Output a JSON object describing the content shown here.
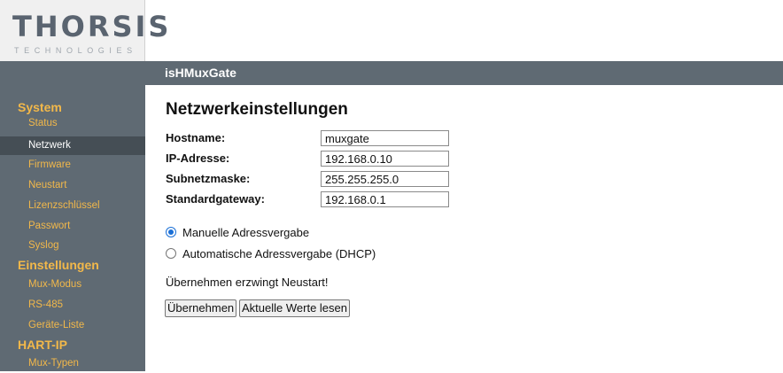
{
  "logo": {
    "name": "THORSIS",
    "tagline": "TECHNOLOGIES"
  },
  "header": {
    "title": "isHMuxGate"
  },
  "sidebar": {
    "sections": [
      {
        "title": "System",
        "items": [
          "Status",
          "Netzwerk",
          "Firmware",
          "Neustart",
          "Lizenzschlüssel",
          "Passwort",
          "Syslog"
        ]
      },
      {
        "title": "Einstellungen",
        "items": [
          "Mux-Modus",
          "RS-485",
          "Geräte-Liste"
        ]
      },
      {
        "title": "HART-IP",
        "items": [
          "Mux-Typen"
        ]
      }
    ],
    "active_item": "Netzwerk"
  },
  "main": {
    "title": "Netzwerkeinstellungen",
    "fields": [
      {
        "label": "Hostname:",
        "value": "muxgate"
      },
      {
        "label": "IP-Adresse:",
        "value": "192.168.0.10"
      },
      {
        "label": "Subnetzmaske:",
        "value": "255.255.255.0"
      },
      {
        "label": "Standardgateway:",
        "value": "192.168.0.1"
      }
    ],
    "radios": [
      {
        "label": "Manuelle Adressvergabe",
        "checked": true
      },
      {
        "label": "Automatische Adressvergabe (DHCP)",
        "checked": false
      }
    ],
    "notice": "Übernehmen erzwingt Neustart!",
    "buttons": {
      "apply": "Übernehmen",
      "read": "Aktuelle Werte lesen"
    }
  },
  "colors": {
    "sidebar_bg": "#5f6a73",
    "accent": "#f2b84a",
    "active_bg": "#454e55",
    "radio_checked": "#1a6fd6"
  }
}
